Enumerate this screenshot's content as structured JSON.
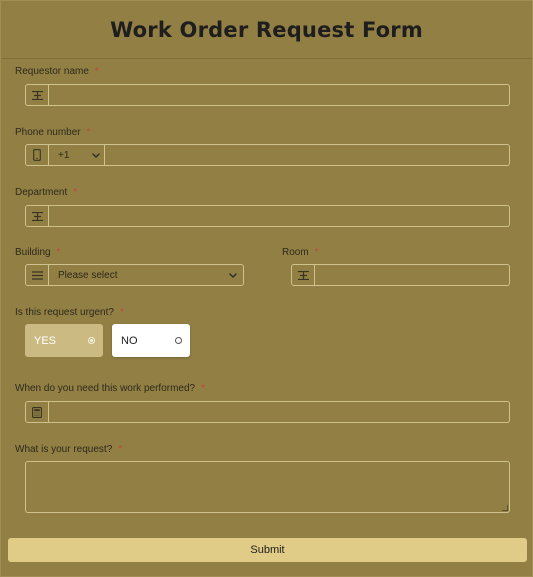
{
  "form": {
    "title": "Work Order Request Form",
    "required_marker": "*",
    "submit_label": "Submit",
    "colors": {
      "background": "#917f44",
      "submit": "#e0cb87",
      "selected_choice": "#cbbb82",
      "required": "#c4453a"
    }
  },
  "fields": {
    "requestor_name": {
      "label": "Requestor name",
      "icon": "text-cursor-icon",
      "value": ""
    },
    "phone_number": {
      "label": "Phone number",
      "icon": "phone-icon",
      "country_code": "+1",
      "value": ""
    },
    "department": {
      "label": "Department",
      "icon": "text-cursor-icon",
      "value": ""
    },
    "building": {
      "label": "Building",
      "icon": "list-icon",
      "selected": "Please select"
    },
    "room": {
      "label": "Room",
      "icon": "text-cursor-icon",
      "value": ""
    },
    "urgent": {
      "label": "Is this request urgent?",
      "options": [
        "YES",
        "NO"
      ],
      "selected": "YES"
    },
    "date_needed": {
      "label": "When do you need this work performed?",
      "icon": "calculator-icon",
      "value": ""
    },
    "request": {
      "label": "What is your request?",
      "value": ""
    }
  }
}
